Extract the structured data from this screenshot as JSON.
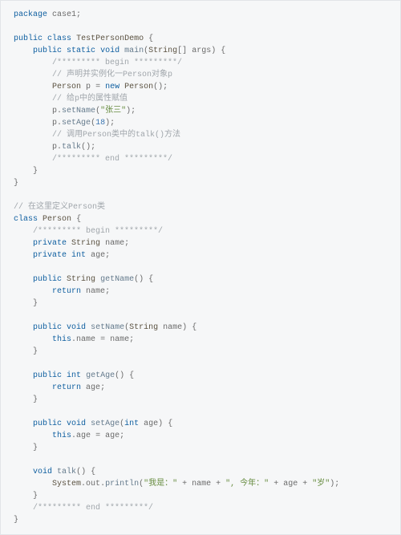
{
  "code": {
    "l01": {
      "kw_package": "package",
      "pkg": "case1",
      "semi": ";"
    },
    "l03": {
      "kw_public": "public",
      "kw_class": "class",
      "cls": "TestPersonDemo",
      "ob": "{"
    },
    "l04": {
      "kw_public": "public",
      "kw_static": "static",
      "kw_void": "void",
      "mth": "main",
      "op": "(",
      "argty": "String",
      "arr": "[]",
      "arg": "args",
      "cp": ")",
      "ob": "{"
    },
    "l05": {
      "cmt": "/********* begin *********/"
    },
    "l06": {
      "cmt": "// 声明并实例化一Person对象p"
    },
    "l07": {
      "cls": "Person",
      "var": "p",
      "eq": "=",
      "kw_new": "new",
      "ctor": "Person",
      "call": "();"
    },
    "l08": {
      "cmt": "// 给p中的属性赋值"
    },
    "l09": {
      "obj": "p",
      "dot": ".",
      "mth": "setName",
      "op": "(",
      "str": "\"张三\"",
      "cp": ");"
    },
    "l10": {
      "obj": "p",
      "dot": ".",
      "mth": "setAge",
      "op": "(",
      "num": "18",
      "cp": ");"
    },
    "l11": {
      "cmt": "// 调用Person类中的talk()方法"
    },
    "l12": {
      "obj": "p",
      "dot": ".",
      "mth": "talk",
      "call": "();"
    },
    "l13": {
      "cmt": "/********* end *********/"
    },
    "l14": {
      "cb": "}"
    },
    "l15": {
      "cb": "}"
    },
    "l17": {
      "cmt": "// 在这里定义Person类"
    },
    "l18": {
      "kw_class": "class",
      "cls": "Person",
      "ob": "{"
    },
    "l19": {
      "cmt": "/********* begin *********/"
    },
    "l20": {
      "kw_private": "private",
      "ty": "String",
      "var": "name",
      "semi": ";"
    },
    "l21": {
      "kw_private": "private",
      "ty": "int",
      "var": "age",
      "semi": ";"
    },
    "l23": {
      "kw_public": "public",
      "ty": "String",
      "mth": "getName",
      "sig": "()",
      "ob": "{"
    },
    "l24": {
      "kw_return": "return",
      "var": "name",
      "semi": ";"
    },
    "l25": {
      "cb": "}"
    },
    "l27": {
      "kw_public": "public",
      "kw_void": "void",
      "mth": "setName",
      "op": "(",
      "argty": "String",
      "arg": "name",
      "cp": ")",
      "ob": "{"
    },
    "l28": {
      "kw_this": "this",
      "dot": ".",
      "field": "name",
      "eq": "=",
      "var": "name",
      "semi": ";"
    },
    "l29": {
      "cb": "}"
    },
    "l31": {
      "kw_public": "public",
      "ty": "int",
      "mth": "getAge",
      "sig": "()",
      "ob": "{"
    },
    "l32": {
      "kw_return": "return",
      "var": "age",
      "semi": ";"
    },
    "l33": {
      "cb": "}"
    },
    "l35": {
      "kw_public": "public",
      "kw_void": "void",
      "mth": "setAge",
      "op": "(",
      "argty": "int",
      "arg": "age",
      "cp": ")",
      "ob": "{"
    },
    "l36": {
      "kw_this": "this",
      "dot": ".",
      "field": "age",
      "eq": "=",
      "var": "age",
      "semi": ";"
    },
    "l37": {
      "cb": "}"
    },
    "l39": {
      "kw_void": "void",
      "mth": "talk",
      "sig": "()",
      "ob": "{"
    },
    "l40": {
      "sys": "System",
      "d1": ".",
      "out": "out",
      "d2": ".",
      "mth": "println",
      "op": "(",
      "s1": "\"我是：\"",
      "p1": " + ",
      "v1": "name",
      "p2": " + ",
      "s2": "\", 今年：\"",
      "p3": " + ",
      "v2": "age",
      "p4": " + ",
      "s3": "\"岁\"",
      "cp": ");"
    },
    "l41": {
      "cb": "}"
    },
    "l42": {
      "cmt": "/********* end *********/"
    },
    "l43": {
      "cb": "}"
    }
  }
}
